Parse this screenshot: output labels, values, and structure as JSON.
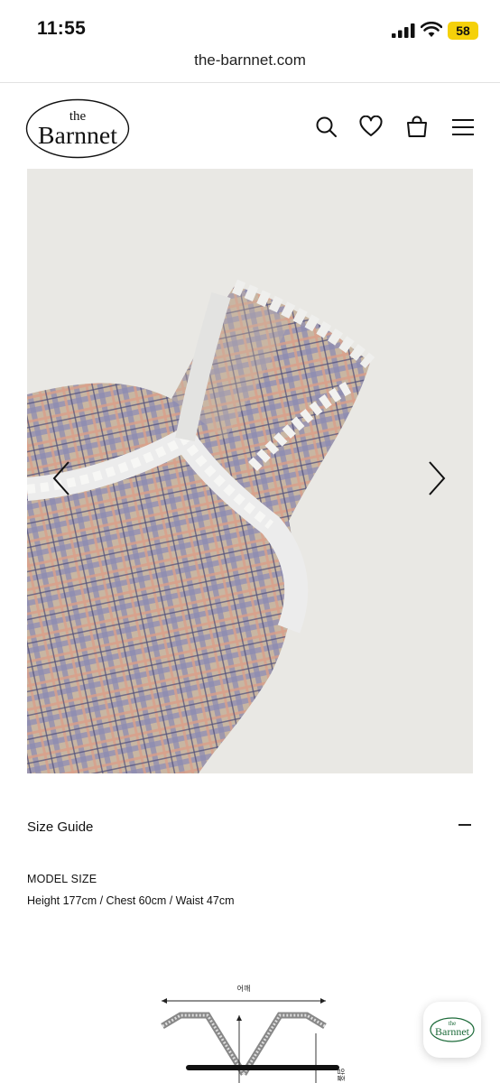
{
  "status_bar": {
    "time": "11:55",
    "battery": "58"
  },
  "browser": {
    "url": "the-barnnet.com"
  },
  "header": {
    "logo_top": "the",
    "logo_main": "Barnnet",
    "icons": [
      "search-icon",
      "heart-icon",
      "bag-icon",
      "menu-icon"
    ]
  },
  "product": {
    "prev_icon": "chevron-left-icon",
    "next_icon": "chevron-right-icon",
    "size_guide_label": "Size Guide",
    "model_size_title": "MODEL SIZE",
    "model_size_text": "Height 177cm / Chest 60cm / Waist 47cm"
  },
  "diagram": {
    "shoulder_label": "어깨",
    "chest_label": "암홀"
  },
  "floating_badge": {
    "logo_top": "the",
    "logo_main": "Barnnet"
  }
}
